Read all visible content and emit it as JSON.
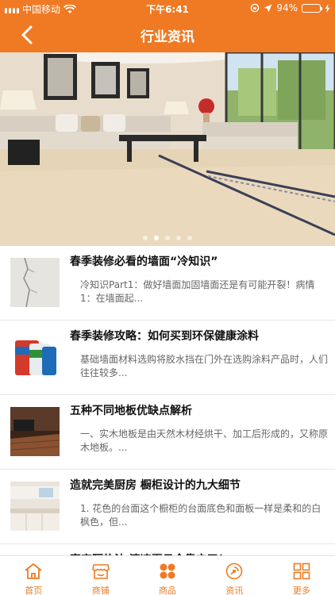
{
  "status_bar": {
    "carrier": "中国移动",
    "time": "下午6:41",
    "battery": "94%",
    "battery_level": 0.94
  },
  "nav": {
    "back_icon": "chevron-left-icon",
    "title": "行业资讯"
  },
  "banner": {
    "slides_count": 5,
    "active_index": 1
  },
  "articles": [
    {
      "title": "春季装修必看的墙面“冷知识”",
      "desc": "冷知识Part1：做好墙面加固墙面还是有可能开裂！病情1：在墙面起..."
    },
    {
      "title": "春季装修攻略：如何买到环保健康涂料",
      "desc": "基础墙面材料选购将胶水挡在门外在选购涂料产品时，人们往往较多..."
    },
    {
      "title": "五种不同地板优缺点解析",
      "desc": "一、实木地板是由天然木材经烘干、加工后形成的，又称原木地板。..."
    },
    {
      "title": "造就完美厨房 橱柜设计的九大细节",
      "desc": "1. 花色的台面这个橱柜的台面底色和面板一样是柔和的白枫色，但..."
    },
    {
      "title": "窗帘隔热法 清凉夏日全靠它了！",
      "desc": ""
    }
  ],
  "tabs": [
    {
      "label": "首页",
      "icon": "home-icon"
    },
    {
      "label": "商铺",
      "icon": "shop-icon"
    },
    {
      "label": "商品",
      "icon": "products-icon"
    },
    {
      "label": "资讯",
      "icon": "news-icon"
    },
    {
      "label": "更多",
      "icon": "more-grid-icon"
    }
  ],
  "colors": {
    "accent": "#ef7a23",
    "battery_fill": "#3ddc5a"
  }
}
